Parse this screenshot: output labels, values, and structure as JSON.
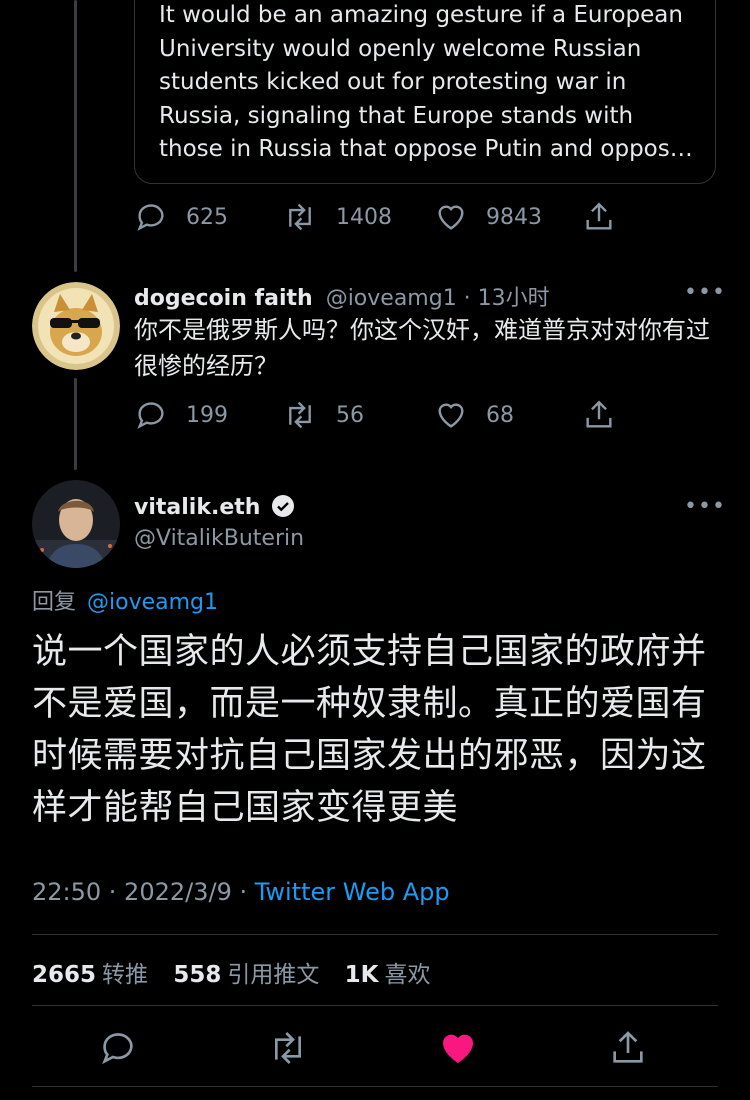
{
  "quoted_tweet": {
    "text": "It would be an amazing gesture if a European University would openly welcome Russian students kicked out for protesting war in Russia, signaling that Europe stands with those in Russia that oppose Putin and oppos…",
    "replies": "625",
    "retweets": "1408",
    "likes": "9843"
  },
  "reply_tweet": {
    "display_name": "dogecoin faith",
    "handle_time": "@ioveamg1 · 13小时",
    "more": "•••",
    "text": "你不是俄罗斯人吗？你这个汉奸，难道普京对对你有过很惨的经历？",
    "replies": "199",
    "retweets": "56",
    "likes": "68"
  },
  "main_tweet": {
    "display_name": "vitalik.eth",
    "handle": "@VitalikButerin",
    "more": "•••",
    "reply_to_label": "回复",
    "reply_to_handle": "@ioveamg1",
    "text": "说一个国家的人必须支持自己国家的政府并不是爱国，而是一种奴隶制。真正的爱国有时候需要对抗自己国家发出的邪恶，因为这样才能帮自己国家变得更美",
    "time_date": "22:50 · 2022/3/9 · ",
    "source": "Twitter Web App",
    "retweet_count": "2665",
    "retweet_label": "转推",
    "quote_count": "558",
    "quote_label": "引用推文",
    "like_count": "1K",
    "like_label": "喜欢"
  },
  "colors": {
    "background": "#000000",
    "muted": "#8b98a5",
    "link": "#1d9bf0",
    "like_active": "#f91880"
  }
}
